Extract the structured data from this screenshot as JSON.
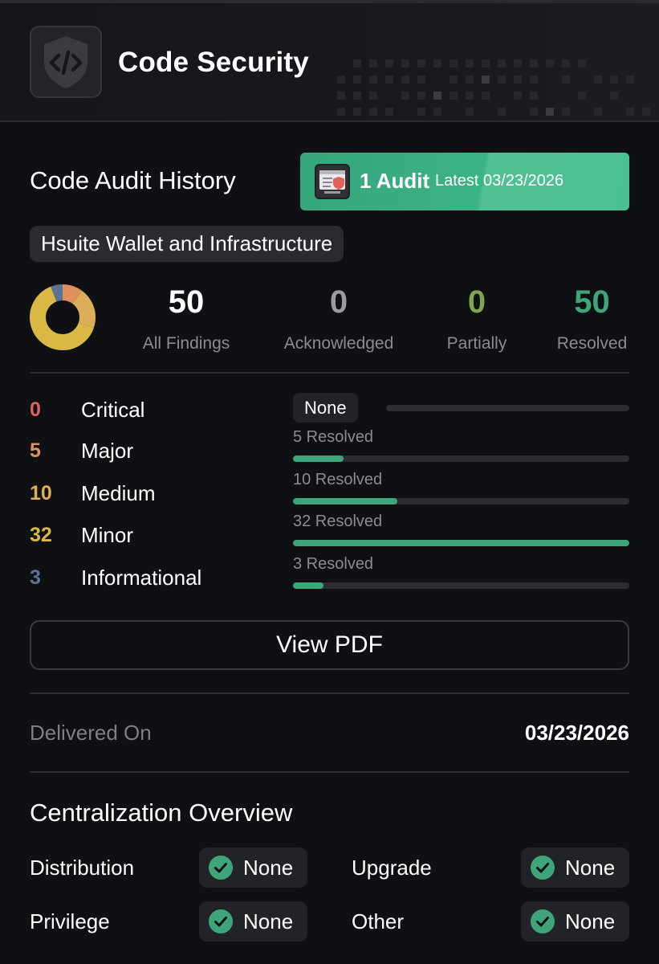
{
  "header": {
    "title": "Code Security",
    "icon": "code-shield-icon"
  },
  "audit": {
    "section_title": "Code Audit History",
    "count_label": "1 Audit",
    "latest_label": "Latest 03/23/2026",
    "banner_color": "#3bb385",
    "project": "Hsuite Wallet and Infrastructure"
  },
  "stats": {
    "all_findings": {
      "value": "50",
      "label": "All Findings",
      "color": "#ffffff"
    },
    "acknowledged": {
      "value": "0",
      "label": "Acknowledged",
      "color": "#9a9ba1"
    },
    "partially": {
      "value": "0",
      "label": "Partially",
      "color": "#7fa64a"
    },
    "resolved": {
      "value": "50",
      "label": "Resolved",
      "color": "#3ea57b"
    }
  },
  "severities": [
    {
      "count": "0",
      "label": "Critical",
      "color": "#e0625b",
      "resolved_label": "None",
      "resolved_fraction": 0
    },
    {
      "count": "5",
      "label": "Major",
      "color": "#e0905e",
      "resolved_label": "5 Resolved",
      "resolved_fraction": 0.15
    },
    {
      "count": "10",
      "label": "Medium",
      "color": "#dcae5a",
      "resolved_label": "10 Resolved",
      "resolved_fraction": 0.31
    },
    {
      "count": "32",
      "label": "Minor",
      "color": "#d9b843",
      "resolved_label": "32 Resolved",
      "resolved_fraction": 1.0
    },
    {
      "count": "3",
      "label": "Informational",
      "color": "#5c7396",
      "resolved_label": "3 Resolved",
      "resolved_fraction": 0.09
    }
  ],
  "donut_colors": [
    "#e0625b",
    "#e0905e",
    "#dcae5a",
    "#d9b843",
    "#5c7396"
  ],
  "pdf_button": "View PDF",
  "delivered": {
    "label": "Delivered On",
    "date": "03/23/2026"
  },
  "centralization": {
    "title": "Centralization Overview",
    "items": [
      {
        "label": "Distribution",
        "value": "None"
      },
      {
        "label": "Upgrade",
        "value": "None"
      },
      {
        "label": "Privilege",
        "value": "None"
      },
      {
        "label": "Other",
        "value": "None"
      }
    ],
    "check_color": "#3ea57b"
  }
}
